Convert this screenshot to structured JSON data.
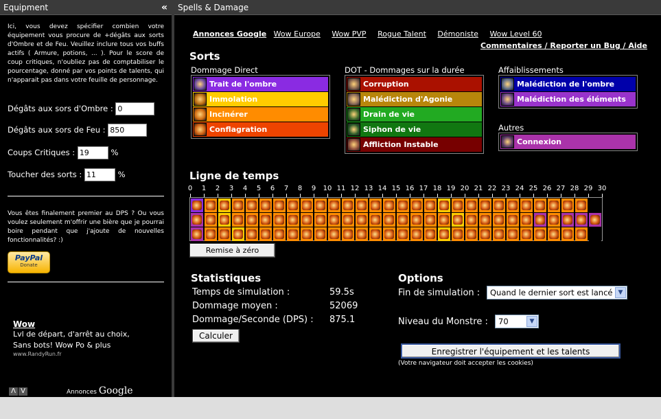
{
  "left_panel": {
    "title": "Equipment",
    "collapse_icon": "«",
    "intro": "Ici, vous devez spécifier combien votre équipement vous procure de +dégâts aux sorts d'Ombre et de Feu. Veuillez inclure tous vos buffs actifs ( Armure, potions, ... ). Pour le score de coup critiques, n'oubliez pas de comptabiliser le pourcentage, donné par vos points de talents, qui n'apparait pas dans votre feuille de personnage.",
    "fields": [
      {
        "label": "Dégâts aux sors d'Ombre :",
        "value": "0",
        "suffix": ""
      },
      {
        "label": "Dégâts aux sors de Feu :",
        "value": "850",
        "suffix": ""
      },
      {
        "label": "Coups Critiques :",
        "value": "19",
        "suffix": "%"
      },
      {
        "label": "Toucher des sorts :",
        "value": "11",
        "suffix": "%"
      }
    ],
    "dps_note": "Vous êtes finalement premier au DPS ? Ou vous voulez seulement m'offrir une bière que je pourrai boire pendant que j'ajoute de nouvelles fonctionnalités? :)",
    "paypal": {
      "brand": "PayPal",
      "label": "Donate"
    },
    "ad": {
      "title": "Wow",
      "line1": "Lvl de départ, d'arrêt au choix,",
      "line2": "Sans bots! Wow Po & plus",
      "url": "www.RandyRun.fr"
    },
    "ad_arrows": [
      "Λ",
      "V"
    ],
    "ad_by": "Annonces",
    "ad_brand": "Google"
  },
  "right_panel": {
    "title": "Spells & Damage",
    "links_lead": "Annonces Google",
    "links": [
      "Wow Europe",
      "Wow PVP",
      "Rogue Talent",
      "Démoniste",
      "Wow Level 60"
    ],
    "feedback": "Commentaires / Reporter un Bug / Aide",
    "sorts_title": "Sorts",
    "groups": {
      "direct": {
        "label": "Dommage Direct",
        "spells": [
          {
            "name": "Trait de l'ombre",
            "bg": "#8a2be2",
            "fg": "#ffffff",
            "icon": "shadow-bolt-icon",
            "ic": "#6a4aa0"
          },
          {
            "name": "Immolation",
            "bg": "#ffcc00",
            "fg": "#ffffff",
            "icon": "immolate-icon",
            "ic": "#b86a10"
          },
          {
            "name": "Incinérer",
            "bg": "#ff8c00",
            "fg": "#ffffff",
            "icon": "incinerate-icon",
            "ic": "#d06a10"
          },
          {
            "name": "Conflagration",
            "bg": "#ee4400",
            "fg": "#ffffff",
            "icon": "conflagrate-icon",
            "ic": "#c85a10"
          }
        ]
      },
      "dot": {
        "label": "DOT - Dommages sur la durée",
        "spells": [
          {
            "name": "Corruption",
            "bg": "#aa1100",
            "fg": "#ffffff",
            "icon": "corruption-icon",
            "ic": "#7a5a4a"
          },
          {
            "name": "Malédiction d'Agonie",
            "bg": "#b8860b",
            "fg": "#ffffff",
            "icon": "agony-icon",
            "ic": "#8a6a5a"
          },
          {
            "name": "Drain de vie",
            "bg": "#22aa22",
            "fg": "#ffffff",
            "icon": "drain-life-icon",
            "ic": "#3a6a2a"
          },
          {
            "name": "Siphon de vie",
            "bg": "#117711",
            "fg": "#ffffff",
            "icon": "siphon-life-icon",
            "ic": "#2a5a2a"
          },
          {
            "name": "Affliction Instable",
            "bg": "#770000",
            "fg": "#ffffff",
            "icon": "unstable-affliction-icon",
            "ic": "#8a4a3a"
          }
        ]
      },
      "weakness": {
        "label": "Affaiblissements",
        "spells": [
          {
            "name": "Malédiction de l'ombre",
            "bg": "#0000aa",
            "fg": "#ffffff",
            "icon": "curse-shadow-icon",
            "ic": "#5a6a8a"
          },
          {
            "name": "Malédiction des éléments",
            "bg": "#9933cc",
            "fg": "#ffffff",
            "icon": "curse-elements-icon",
            "ic": "#6a4a8a"
          }
        ]
      },
      "others": {
        "label": "Autres",
        "spells": [
          {
            "name": "Connexion",
            "bg": "#aa33aa",
            "fg": "#ffffff",
            "icon": "life-tap-icon",
            "ic": "#5a3a6a"
          }
        ]
      }
    },
    "timeline_title": "Ligne de temps",
    "timeline_ticks": [
      "0",
      "1",
      "2",
      "3",
      "4",
      "5",
      "6",
      "7",
      "8",
      "9",
      "10",
      "11",
      "12",
      "13",
      "14",
      "15",
      "16",
      "17",
      "18",
      "19",
      "20",
      "21",
      "22",
      "23",
      "24",
      "25",
      "26",
      "27",
      "28",
      "29",
      "30"
    ],
    "reset_label": "Remise à zéro",
    "stats_title": "Statistiques",
    "stats": [
      {
        "label": "Temps de simulation :",
        "value": "59.5s"
      },
      {
        "label": "Dommage moyen :",
        "value": "52069"
      },
      {
        "label": "Dommage/Seconde (DPS) :",
        "value": "875.1"
      }
    ],
    "calc_label": "Calculer",
    "options_title": "Options",
    "sim_end_label": "Fin de simulation :",
    "sim_end_value": "Quand le dernier sort est lancé",
    "monster_label": "Niveau du Monstre :",
    "monster_value": "70",
    "save_label": "Enregistrer l'équipement et les talents",
    "cookies_note": "(Votre navigateur doit accepter les cookies)"
  }
}
